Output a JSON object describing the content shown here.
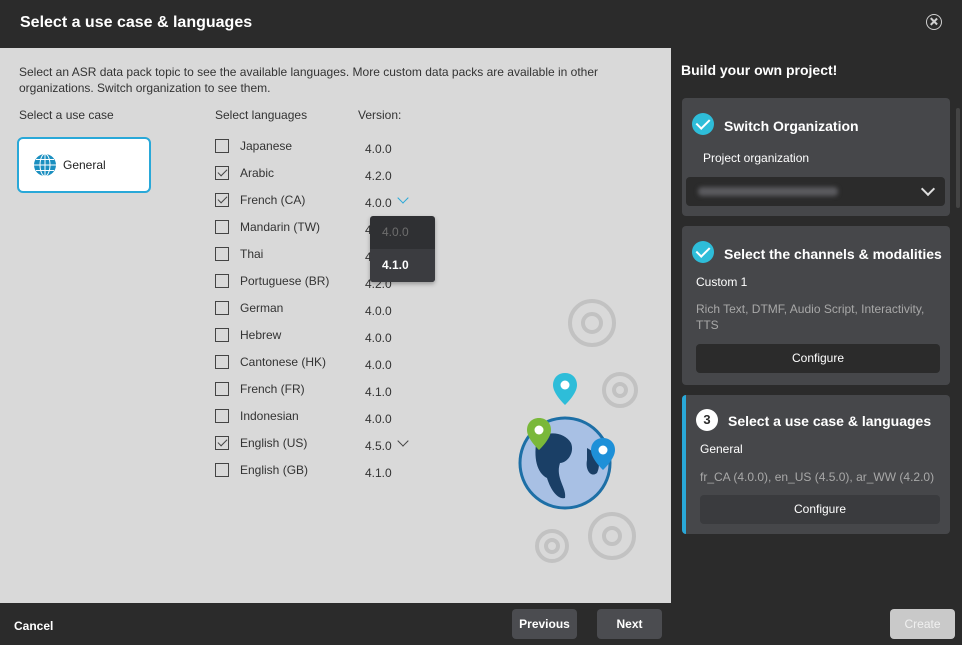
{
  "dialog": {
    "title": "Select a use case & languages"
  },
  "main": {
    "intro": "Select an ASR data pack topic to see the available languages. More custom data packs are available in other organizations. Switch organization to see them.",
    "usecase_header": "Select a use case",
    "languages_header": "Select languages",
    "version_header": "Version:",
    "usecase": {
      "label": "General",
      "icon": "globe-icon"
    },
    "languages": [
      {
        "name": "Japanese",
        "checked": false,
        "version": "4.0.0"
      },
      {
        "name": "Arabic",
        "checked": true,
        "version": "4.2.0"
      },
      {
        "name": "French (CA)",
        "checked": true,
        "version": "4.0.0"
      },
      {
        "name": "Mandarin (TW)",
        "checked": false,
        "version": "4.0.0"
      },
      {
        "name": "Thai",
        "checked": false,
        "version": "4.0.0"
      },
      {
        "name": "Portuguese (BR)",
        "checked": false,
        "version": "4.2.0"
      },
      {
        "name": "German",
        "checked": false,
        "version": "4.0.0"
      },
      {
        "name": "Hebrew",
        "checked": false,
        "version": "4.0.0"
      },
      {
        "name": "Cantonese (HK)",
        "checked": false,
        "version": "4.0.0"
      },
      {
        "name": "French (FR)",
        "checked": false,
        "version": "4.1.0"
      },
      {
        "name": "Indonesian",
        "checked": false,
        "version": "4.0.0"
      },
      {
        "name": "English (US)",
        "checked": true,
        "version": "4.5.0"
      },
      {
        "name": "English (GB)",
        "checked": false,
        "version": "4.1.0"
      }
    ],
    "version_dropdown": {
      "options": [
        "4.0.0",
        "4.1.0"
      ],
      "disabled": "4.0.0",
      "highlighted": "4.1.0"
    }
  },
  "sidebar": {
    "title": "Build your own project!",
    "step1": {
      "title": "Switch Organization",
      "subtitle": "Project organization"
    },
    "step2": {
      "title": "Select the channels & modalities",
      "subtitle": "Custom 1",
      "description": "Rich Text, DTMF, Audio Script, Interactivity, TTS",
      "button": "Configure"
    },
    "step3": {
      "number": "3",
      "title": "Select a use case & languages",
      "subtitle": "General",
      "description": "fr_CA (4.0.0), en_US (4.5.0), ar_WW (4.2.0)",
      "button": "Configure"
    }
  },
  "footer": {
    "cancel": "Cancel",
    "previous": "Previous",
    "next": "Next",
    "create": "Create"
  },
  "colors": {
    "accent": "#29a8d8",
    "check_badge": "#2ebdd9",
    "panel": "#2b2b2b",
    "card": "#46474a",
    "content_bg": "#d9d9d9"
  }
}
